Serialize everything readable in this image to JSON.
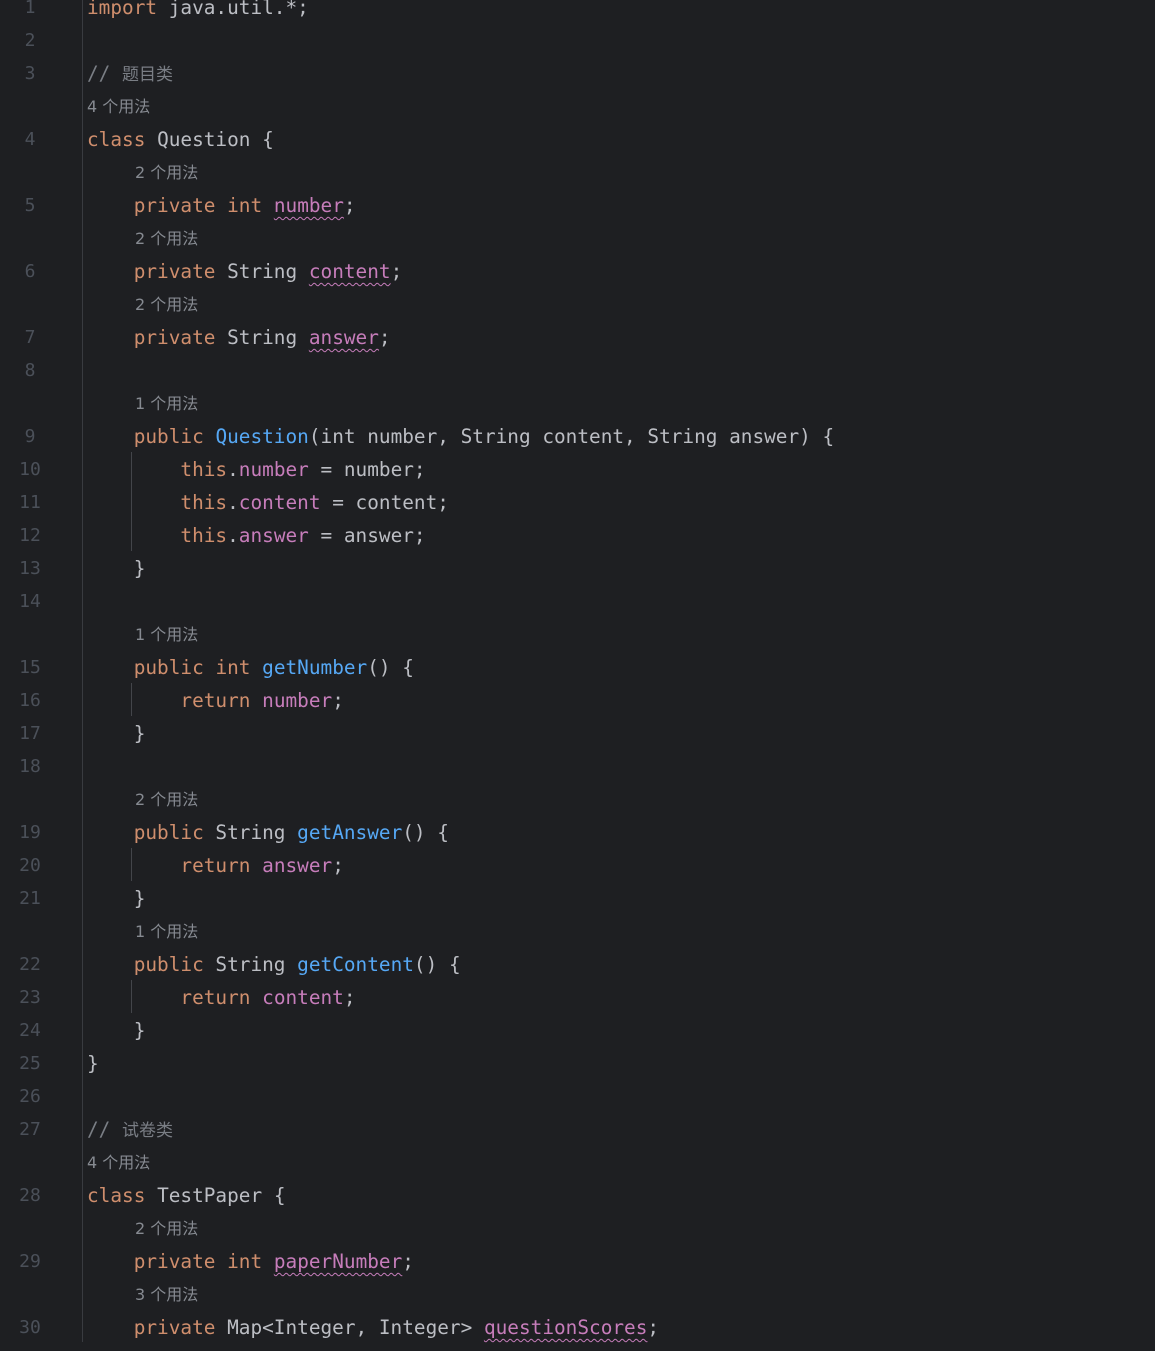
{
  "editor": {
    "language": "java",
    "usage": {
      "u1": "1 个用法",
      "u2": "2 个用法",
      "u3": "3 个用法",
      "u4": "4 个用法"
    },
    "line_numbers": [
      "1",
      "2",
      "3",
      "4",
      "5",
      "6",
      "7",
      "8",
      "9",
      "10",
      "11",
      "12",
      "13",
      "14",
      "15",
      "16",
      "17",
      "18",
      "19",
      "20",
      "21",
      "22",
      "23",
      "24",
      "25",
      "26",
      "27",
      "28",
      "29",
      "30"
    ],
    "tokens": {
      "import": "import",
      "import_path": " java.util.*;",
      "comment_slash": "// ",
      "comment_question": "题目类",
      "comment_paper": "试卷类",
      "class": "class",
      "question": "Question",
      "testpaper": "TestPaper",
      "open_brace": " {",
      "close_brace": "}",
      "private": "private",
      "public": "public",
      "int": "int",
      "string": " String",
      "number": "number",
      "content": "content",
      "answer": "answer",
      "semicolon": ";",
      "ctor_params": "(int number, String content, String answer) {",
      "this": "this",
      "dot": ".",
      "assign_number": " = number;",
      "assign_content": " = content;",
      "assign_answer": " = answer;",
      "getNumber": "getNumber",
      "getAnswer": "getAnswer",
      "getContent": "getContent",
      "parens": "() {",
      "return": "return",
      "paperNumber": "paperNumber",
      "map_type": " Map<Integer, Integer> ",
      "questionScores": "questionScores"
    },
    "colors": {
      "background": "#1e1f22",
      "keyword": "#cf8e6d",
      "field": "#c77dbb",
      "method": "#56a8f5",
      "text": "#bcbec4",
      "comment": "#7a7e85",
      "gutter": "#4b5059"
    }
  }
}
